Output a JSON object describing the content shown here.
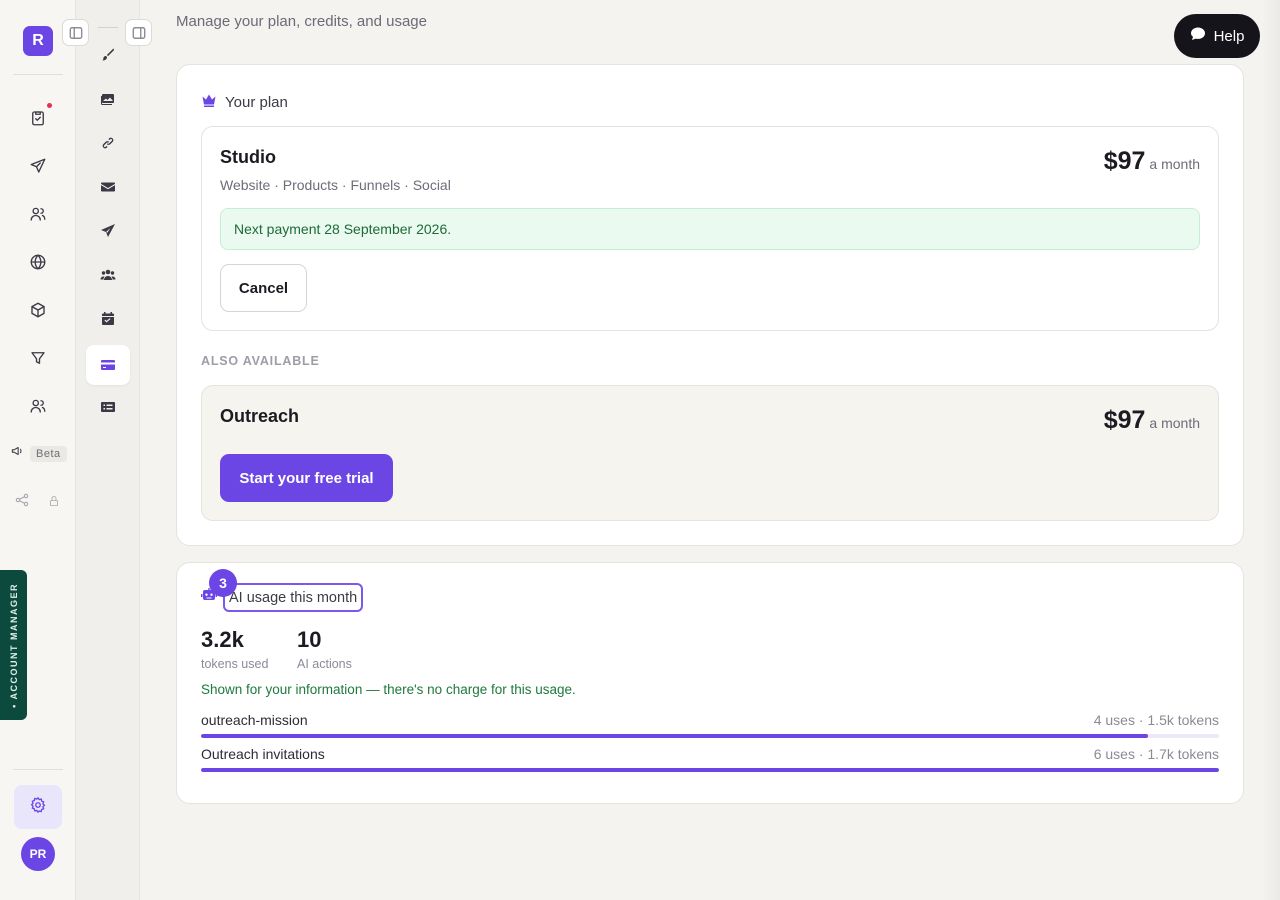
{
  "brand": {
    "initial": "R"
  },
  "rail": {
    "beta_label": "Beta",
    "account_manager_label": "• ACCOUNT MANAGER",
    "avatar_initials": "PR"
  },
  "header": {
    "subtitle": "Manage your plan, credits, and usage",
    "help_label": "Help"
  },
  "plan": {
    "section_title": "Your plan",
    "current": {
      "name": "Studio",
      "features": "Website · Products · Funnels · Social",
      "price": "$97",
      "period": "a month",
      "next_payment": "Next payment 28 September 2026.",
      "cancel_label": "Cancel"
    },
    "also_available_label": "ALSO AVAILABLE",
    "alternative": {
      "name": "Outreach",
      "price": "$97",
      "period": "a month",
      "cta_label": "Start your free trial"
    }
  },
  "usage": {
    "step_number": "3",
    "section_title": "AI usage this month",
    "stats": [
      {
        "value": "3.2k",
        "label": "tokens used"
      },
      {
        "value": "10",
        "label": "AI actions"
      }
    ],
    "note": "Shown for your information — there's no charge for this usage.",
    "rows": [
      {
        "name": "outreach-mission",
        "meta": "4 uses · 1.5k tokens",
        "fraction": 0.93
      },
      {
        "name": "Outreach invitations",
        "meta": "6 uses · 1.7k tokens",
        "fraction": 1.0
      }
    ]
  },
  "colors": {
    "accent": "#6b46e5",
    "success_text": "#1e6a38",
    "account_manager_bg": "#0d4a3e"
  }
}
